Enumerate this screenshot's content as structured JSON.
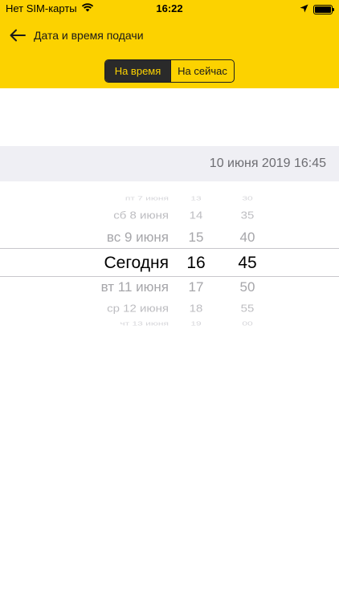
{
  "status_bar": {
    "carrier": "Нет SIM-карты",
    "time": "16:22"
  },
  "nav": {
    "title": "Дата и время подачи"
  },
  "segmented": {
    "options": [
      "На время",
      "На сейчас"
    ],
    "selected": "На время"
  },
  "selected_datetime": "10 июня 2019 16:45",
  "picker": {
    "days": [
      "пт 7 июня",
      "сб 8 июня",
      "вс 9 июня",
      "Сегодня",
      "вт 11 июня",
      "ср 12 июня",
      "чт 13 июня"
    ],
    "hours": [
      "13",
      "14",
      "15",
      "16",
      "17",
      "18",
      "19"
    ],
    "minutes": [
      "30",
      "35",
      "40",
      "45",
      "50",
      "55",
      "00"
    ]
  },
  "colors": {
    "accent": "#fcd200",
    "segment_active_bg": "#2a2a2a",
    "band_bg": "#efeff4"
  }
}
